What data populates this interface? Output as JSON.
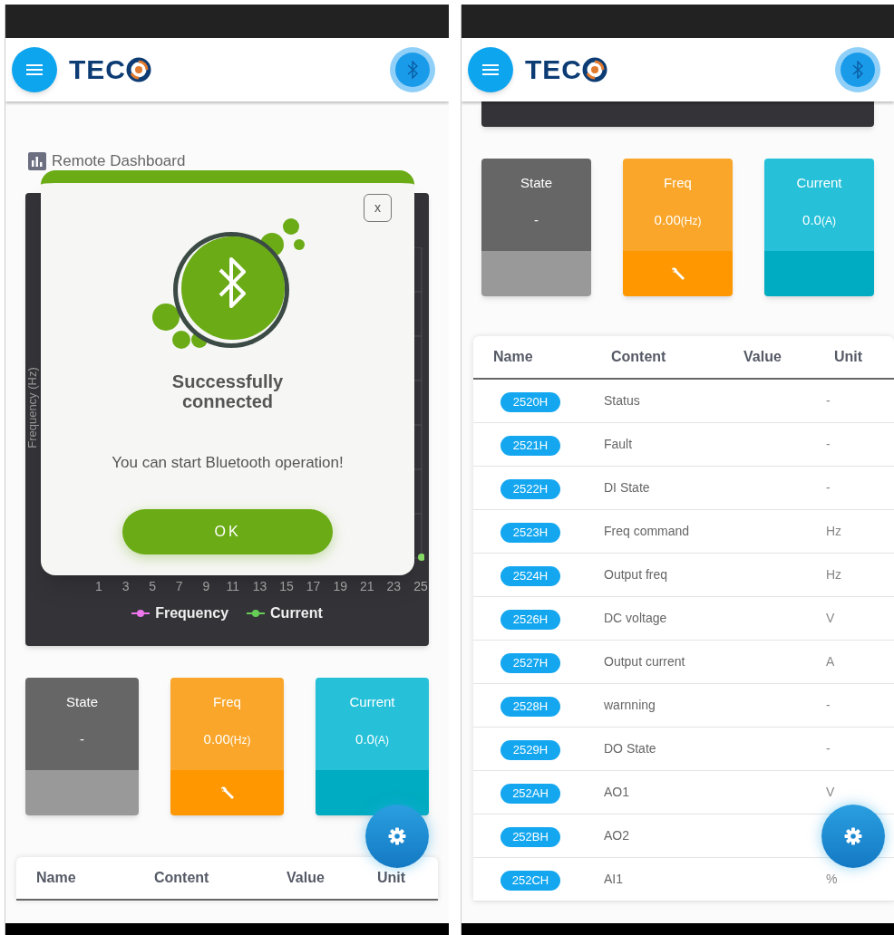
{
  "screens": [
    {
      "header": {
        "logo_text": "TEC"
      },
      "dashboard_title": "Remote Dashboard",
      "chart": {
        "kind": "full",
        "y_axis_label": "Frequency (Hz)",
        "x_tick_labels": [
          "1",
          "3",
          "5",
          "7",
          "9",
          "11",
          "13",
          "15",
          "17",
          "19",
          "21",
          "23",
          "25"
        ],
        "legend": [
          {
            "label": "Frequency",
            "color": "#ee77ee"
          },
          {
            "label": "Current",
            "color": "#66cc55"
          }
        ]
      },
      "cards": [
        {
          "kind": "state",
          "label": "State",
          "value": "-"
        },
        {
          "kind": "freq",
          "label": "Freq",
          "value": "0.00",
          "unit": "(Hz)"
        },
        {
          "kind": "current",
          "label": "Current",
          "value": "0.0",
          "unit": "(A)"
        }
      ],
      "table": {
        "columns": [
          "Name",
          "Content",
          "Value",
          "Unit"
        ]
      },
      "dialog": {
        "close_button": "x",
        "title": "Successfully connected",
        "message": "You can start Bluetooth operation!",
        "ok_button": "OK"
      }
    },
    {
      "header": {
        "logo_text": "TEC"
      },
      "chart": {
        "kind": "cut"
      },
      "cards": [
        {
          "kind": "state",
          "label": "State",
          "value": "-"
        },
        {
          "kind": "freq",
          "label": "Freq",
          "value": "0.00",
          "unit": "(Hz)"
        },
        {
          "kind": "current",
          "label": "Current",
          "value": "0.0",
          "unit": "(A)"
        }
      ],
      "table": {
        "columns": [
          "Name",
          "Content",
          "Value",
          "Unit"
        ],
        "rows": [
          {
            "name": "2520H",
            "content": "Status",
            "unit": "-"
          },
          {
            "name": "2521H",
            "content": "Fault",
            "unit": "-"
          },
          {
            "name": "2522H",
            "content": "DI State",
            "unit": "-"
          },
          {
            "name": "2523H",
            "content": "Freq command",
            "unit": "Hz"
          },
          {
            "name": "2524H",
            "content": "Output freq",
            "unit": "Hz"
          },
          {
            "name": "2526H",
            "content": "DC voltage",
            "unit": "V"
          },
          {
            "name": "2527H",
            "content": "Output current",
            "unit": "A"
          },
          {
            "name": "2528H",
            "content": "warnning",
            "unit": "-"
          },
          {
            "name": "2529H",
            "content": "DO State",
            "unit": "-"
          },
          {
            "name": "252AH",
            "content": "AO1",
            "unit": "V"
          },
          {
            "name": "252BH",
            "content": "AO2"
          },
          {
            "name": "252CH",
            "content": "AI1",
            "unit": "%"
          }
        ]
      }
    }
  ]
}
